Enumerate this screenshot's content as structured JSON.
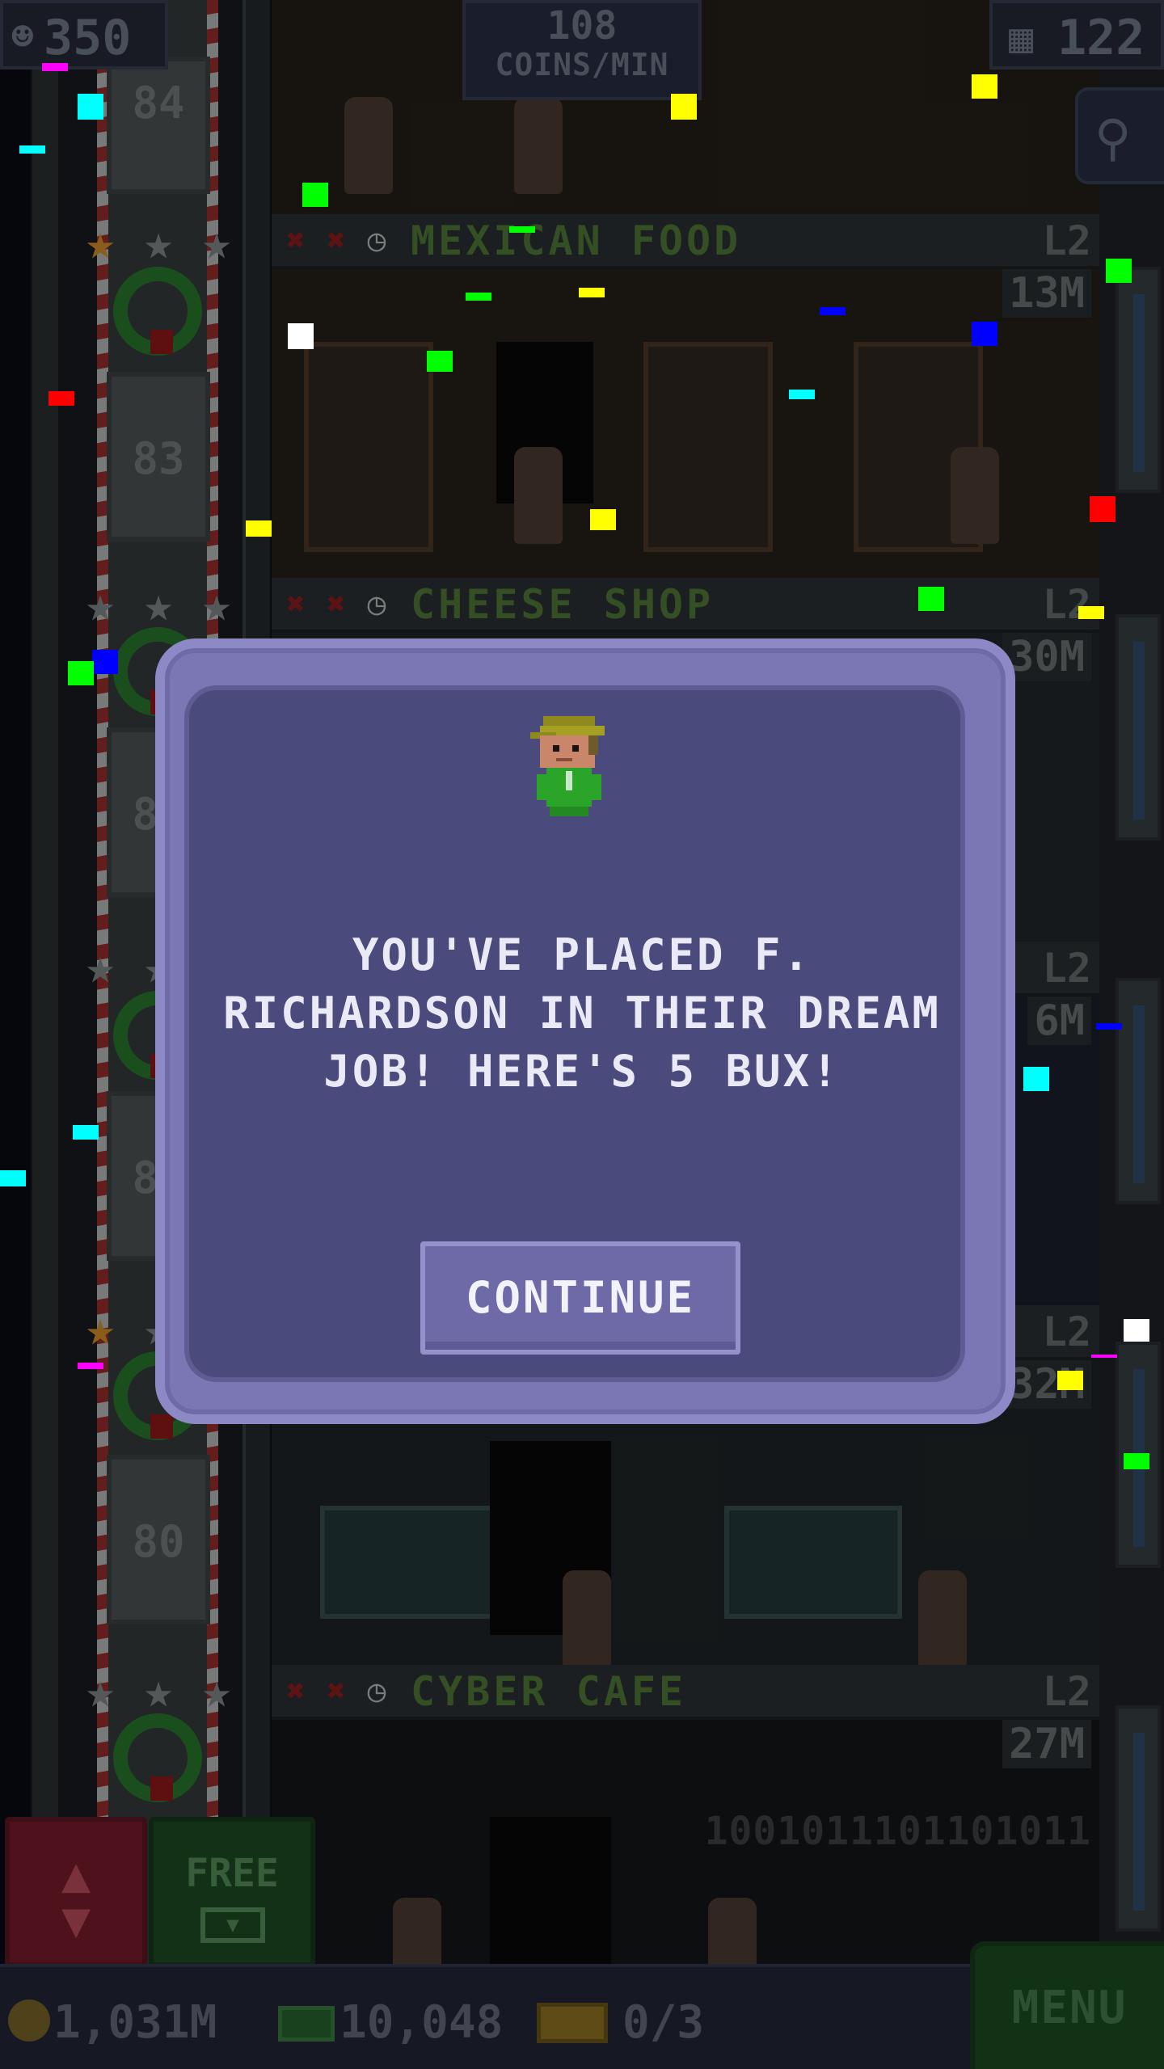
{
  "hud": {
    "population": "350",
    "coins_per_min_value": "108",
    "coins_per_min_label": "COINS/MIN",
    "floors_count": "122"
  },
  "floors": [
    {
      "name": "",
      "level": "",
      "value": "",
      "floor_number": "84"
    },
    {
      "name": "MEXICAN FOOD",
      "level": "L2",
      "value": "13M",
      "floor_number": "83"
    },
    {
      "name": "CHEESE SHOP",
      "level": "L2",
      "value": "30M",
      "floor_number": "82"
    },
    {
      "name": "",
      "level": "L2",
      "value": "6M",
      "floor_number": "81"
    },
    {
      "name": "",
      "level": "L2",
      "value": "32M",
      "floor_number": "80"
    },
    {
      "name": "CYBER CAFE",
      "level": "L2",
      "value": "27M",
      "floor_number": ""
    }
  ],
  "cyber_cafe_binary": "1001011101101011",
  "dialog": {
    "message": "YOU'VE PLACED F. RICHARDSON IN THEIR DREAM JOB! HERE'S 5 BUX!",
    "continue_label": "CONTINUE"
  },
  "controls": {
    "free_label": "FREE",
    "menu_label": "MENU"
  },
  "bottom_bar": {
    "coins": "1,031M",
    "bux": "10,048",
    "tickets": "0/3"
  },
  "icons": {
    "population": "person-icon",
    "floors": "building-icon",
    "search": "magnifier-icon",
    "elevator": "up-down-arrows-icon",
    "coins": "coin-icon",
    "bux": "bux-bill-icon",
    "tickets": "ticket-icon"
  },
  "colors": {
    "dialog_outer": "#7b77b5",
    "dialog_inner": "#4b4a7c",
    "button": "#6d6aa7",
    "text": "#eaeaf6",
    "floor_name_green": "#3c5a28",
    "menu_green": "#153a1a",
    "elevator_red": "#5a1520"
  }
}
